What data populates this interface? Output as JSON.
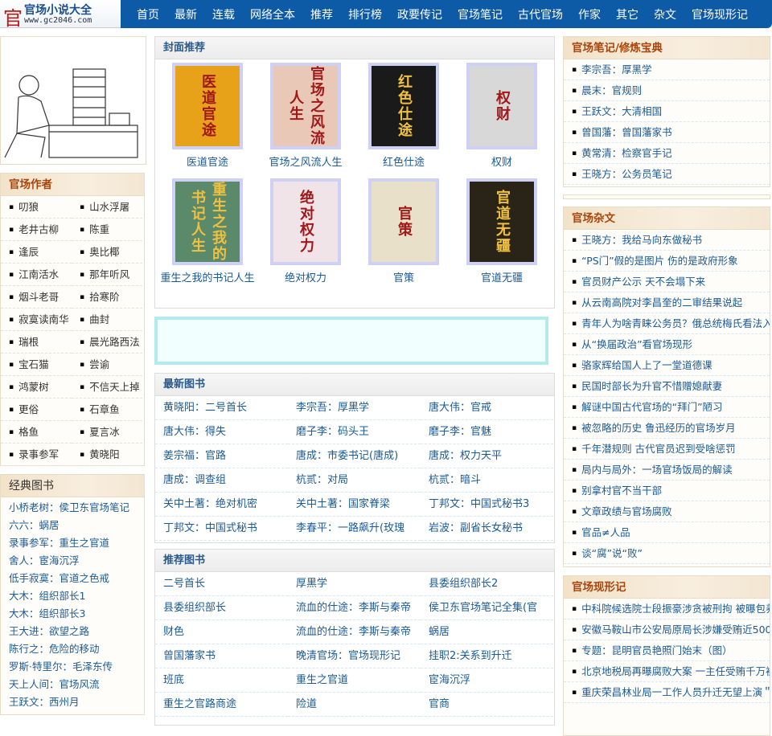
{
  "logo": {
    "title": "官场小说大全",
    "url": "www.gc2046.com"
  },
  "nav": [
    "首页",
    "最新",
    "连载",
    "网络全本",
    "推荐",
    "排行榜",
    "政要传记",
    "官场笔记",
    "古代官场",
    "作家",
    "其它",
    "杂文",
    "官场现形记"
  ],
  "authors": {
    "title": "官场作者",
    "items": [
      "叨狼",
      "山水浮屠",
      "老井古柳",
      "陈重",
      "逢辰",
      "奥比椰",
      "江南活水",
      "那年听风",
      "烟斗老哥",
      "拾寒阶",
      "寂寞读南华",
      "曲封",
      "瑞根",
      "晨光路西法",
      "宝石猫",
      "尝谕",
      "鸿蒙树",
      "不信天上掉",
      "更俗",
      "石章鱼",
      "格鱼",
      "夏言冰",
      "录事参军",
      "黄晓阳"
    ]
  },
  "classic": {
    "title": "经典图书",
    "items": [
      "小桥老树：侯卫东官场笔记",
      "六六：蜗居",
      "录事参军：重生之官道",
      "舍人：宦海沉浮",
      "低手寂寞：官道之色戒",
      "大木：组织部长1",
      "大木：组织部长3",
      "王大进：欲望之路",
      "陈行之：危险的移动",
      "罗斯·特里尔：毛泽东传",
      "天上人间：官场风流",
      "王跃文：西州月"
    ]
  },
  "covers": {
    "title": "封面推荐",
    "items": [
      {
        "title": "医道官途",
        "color": "#e8a21a"
      },
      {
        "title": "官场之风流人生",
        "color": "#e9c8b8"
      },
      {
        "title": "红色仕途",
        "color": "#1a1a1a"
      },
      {
        "title": "权财",
        "color": "#d8d8d8"
      },
      {
        "title": "重生之我的书记人生",
        "color": "#5a8a6a"
      },
      {
        "title": "绝对权力",
        "color": "#f0e4e8"
      },
      {
        "title": "官策",
        "color": "#e8e0c8"
      },
      {
        "title": "官道无疆",
        "color": "#2a2418"
      }
    ]
  },
  "latest": {
    "title": "最新图书",
    "items": [
      "黄晓阳：二号首长",
      "李宗吾：厚黑学",
      "唐大伟：官戒",
      "唐大伟：得失",
      "磨子李：码头王",
      "磨子李：官魅",
      "姜宗福：官路",
      "唐成：市委书记(唐成)",
      "唐成：权力天平",
      "唐成：调查组",
      "杭贰：对局",
      "杭贰：暗斗",
      "关中土著：绝对机密",
      "关中土著：国家脊梁",
      "丁邦文：中国式秘书3",
      "丁邦文：中国式秘书",
      "李春平：一路飙升(玫瑰",
      "岩波：副省长女秘书"
    ]
  },
  "recommend": {
    "title": "推荐图书",
    "items": [
      "二号首长",
      "厚黑学",
      "县委组织部长2",
      "县委组织部长",
      "流血的仕途：李斯与秦帝",
      "侯卫东官场笔记全集(官",
      "财色",
      "流血的仕途：李斯与秦帝",
      "蜗居",
      "曾国藩家书",
      "晚清官场：官场现形记",
      "挂职2:关系到升迁",
      "班底",
      "重生之官道",
      "宦海沉浮",
      "重生之官路商途",
      "险道",
      "官商"
    ]
  },
  "notes": {
    "title": "官场笔记/修炼宝典",
    "items": [
      "李宗吾：厚黑学",
      "晨末：官规则",
      "王跃文：大清相国",
      "曾国藩：曾国藩家书",
      "黄常清：检察官手记",
      "王晓方：公务员笔记"
    ]
  },
  "essays": {
    "title": "官场杂文",
    "items": [
      "王晓方：我给马向东做秘书",
      "“PS门”假的是图片 伤的是政府形象",
      "官员财产公示 天不会塌下来",
      "从云南高院对李昌奎的二审结果说起",
      "青年人为啥青睐公务员？俄总统梅氏看法入",
      "从“换届政治”看官场现形",
      "骆家辉给国人上了一堂道德课",
      "民国时部长为升官不惜赠媳献妻",
      "解谜中国古代官场的“拜门”陋习",
      "被忽略的历史 鲁迅经历的官场岁月",
      "千年潜规则 古代官员迟到受啥惩罚",
      "局内与局外：一场官场饭局的解读",
      "别拿村官不当干部",
      "文章政绩与官场腐败",
      "官品≠人品",
      "谈“腐”说“败”"
    ]
  },
  "xianxing": {
    "title": "官场现形记",
    "items": [
      "中科院候选院士段振豪涉贪被刑拘 被曝包养",
      "安徽马鞍山市公安局原局长涉嫌受贿近500",
      "专题：昆明官员艳照门始末（图）",
      "北京地税局再曝腐败大案 一主任受贿千万被",
      "重庆荣昌林业局一工作人员升迁无望上演＂"
    ]
  }
}
